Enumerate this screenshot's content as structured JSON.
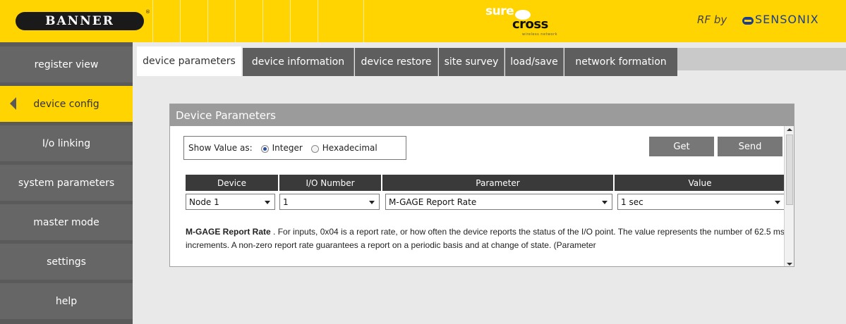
{
  "header": {
    "logo": "BANNER",
    "registered": "®",
    "product_top": "sure",
    "product_bottom": "cross",
    "product_tagline": "wireless network",
    "rf_by": "RF by",
    "partner": "SENSONIX"
  },
  "sidebar": {
    "items": [
      {
        "label": "register view"
      },
      {
        "label": "device config"
      },
      {
        "label": "I/o linking"
      },
      {
        "label": "system parameters"
      },
      {
        "label": "master mode"
      },
      {
        "label": "settings"
      },
      {
        "label": "help"
      }
    ],
    "active_index": 1
  },
  "tabs": [
    {
      "label": "device parameters"
    },
    {
      "label": "device information"
    },
    {
      "label": "device restore"
    },
    {
      "label": "site survey"
    },
    {
      "label": "load/save"
    },
    {
      "label": "network formation"
    }
  ],
  "panel": {
    "title": "Device Parameters",
    "show_value_label": "Show Value as:",
    "options": [
      {
        "label": "Integer",
        "checked": true
      },
      {
        "label": "Hexadecimal",
        "checked": false
      }
    ],
    "get_label": "Get",
    "send_label": "Send",
    "columns": [
      "Device",
      "I/O Number",
      "Parameter",
      "Value"
    ],
    "selected": {
      "device": "Node 1",
      "io_number": "1",
      "parameter": "M-GAGE Report Rate",
      "value": "1 sec"
    },
    "description_title": "M-GAGE Report Rate",
    "description_text": " . For inputs, 0x04 is a report rate, or how often the device reports the status of the I/O point. The value represents the number of 62.5 ms increments. A non-zero report rate guarantees a report on a periodic basis and at change of state. (Parameter"
  },
  "colors": {
    "brand_yellow": "#ffd400",
    "sidebar_gray": "#666666",
    "header_table": "#3a3a3a"
  }
}
